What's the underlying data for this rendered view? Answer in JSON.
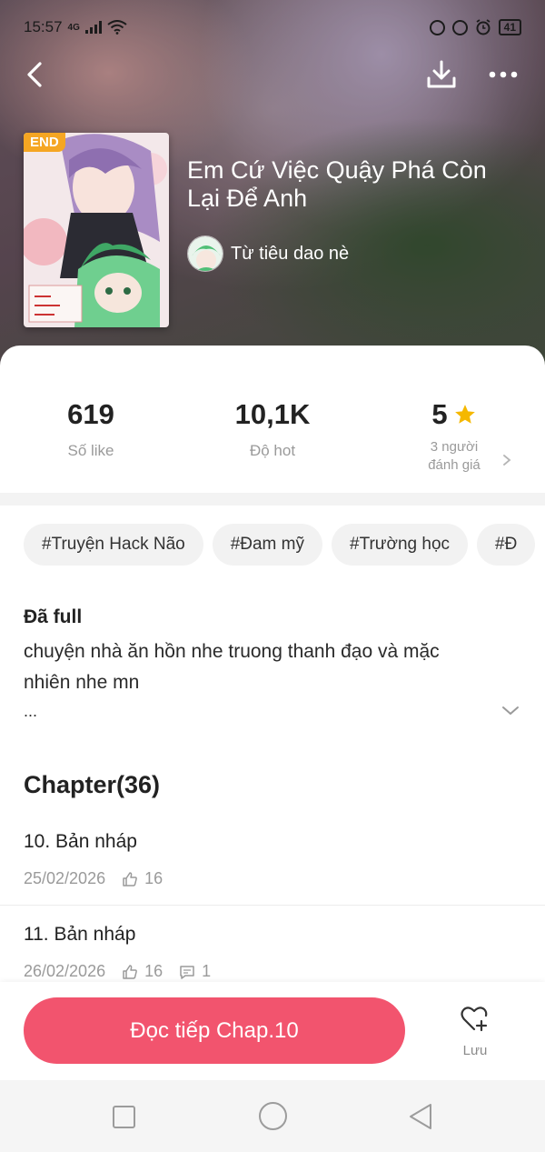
{
  "status_bar": {
    "time": "15:57",
    "network": "4G",
    "battery": "41"
  },
  "story": {
    "badge": "END",
    "title": "Em Cứ Việc Quậy Phá Còn Lại Để Anh",
    "author": "Từ tiêu dao nè"
  },
  "stats": {
    "likes_value": "619",
    "likes_label": "Số like",
    "hot_value": "10,1K",
    "hot_label": "Độ hot",
    "rating_value": "5",
    "rating_label": "3 người đánh giá"
  },
  "tags": [
    "#Truyện Hack Não",
    "#Đam mỹ",
    "#Trường học",
    "#Đ"
  ],
  "description": {
    "heading": "Đã full",
    "text": "chuyện nhà ăn hồn nhe truong thanh đạo và mặc nhiên nhe mn",
    "ellipsis": "..."
  },
  "chapters": {
    "heading": "Chapter(36)",
    "items": [
      {
        "title": "10. Bản nháp",
        "date": "25/02/2026",
        "likes": "16"
      },
      {
        "title": "11. Bản nháp",
        "date": "26/02/2026",
        "likes": "16",
        "comments": "1"
      }
    ]
  },
  "actions": {
    "read_label": "Đọc tiếp Chap.10",
    "save_label": "Lưu"
  },
  "colors": {
    "accent": "#f2546e",
    "badge": "#f5a623",
    "star": "#f5b800"
  },
  "icons": [
    "back-icon",
    "download-icon",
    "more-icon",
    "star-icon",
    "chevron-right-icon",
    "chevron-down-icon",
    "thumb-up-icon",
    "comment-icon",
    "heart-add-icon"
  ]
}
